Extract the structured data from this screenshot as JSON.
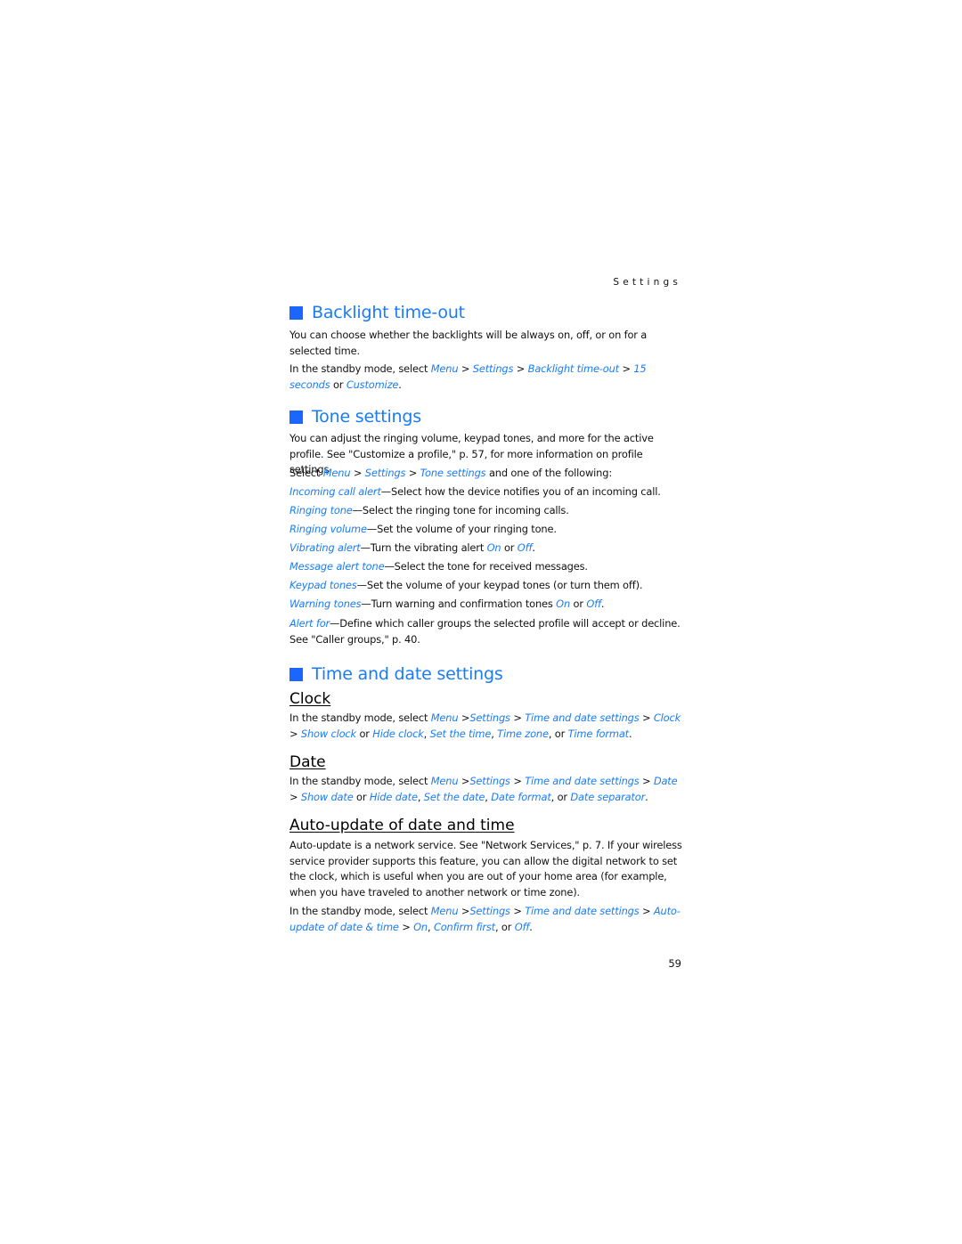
{
  "running_header": "Settings",
  "page_number": "59",
  "accent_color": "#1a7cf5",
  "sections": {
    "backlight": {
      "title": "Backlight time-out",
      "p1": "You can choose whether the backlights will be always on, off, or on for a selected time.",
      "p2": {
        "t1": "In the standby mode, select ",
        "l1": "Menu",
        "s1": " > ",
        "l2": "Settings",
        "s2": " > ",
        "l3": "Backlight time-out",
        "s3": " > ",
        "l4": "15 seconds",
        "s4": " or ",
        "l5": "Customize",
        "end": "."
      }
    },
    "tone": {
      "title": "Tone settings",
      "p1": "You can adjust the ringing volume, keypad tones, and more for the active profile. See \"Customize a profile,\" p. 57, for more information on profile settings.",
      "p2": {
        "t1": "Select ",
        "l1": "Menu",
        "s1": " > ",
        "l2": "Settings",
        "s2": " > ",
        "l3": "Tone settings",
        "t2": " and one of the following:"
      },
      "items": [
        {
          "term": "Incoming call alert",
          "desc": "—Select how the device notifies you of an incoming call."
        },
        {
          "term": "Ringing tone",
          "desc": "—Select the ringing tone for incoming calls."
        },
        {
          "term": "Ringing volume",
          "desc": "—Set the volume of your ringing tone."
        },
        {
          "term": "Vibrating alert",
          "desc": "—Turn the vibrating alert ",
          "on": "On",
          "or": " or ",
          "off": "Off",
          "end": "."
        },
        {
          "term": "Message alert tone",
          "desc": "—Select the tone for received messages."
        },
        {
          "term": "Keypad tones",
          "desc": "—Set the volume of your keypad tones (or turn them off)."
        },
        {
          "term": "Warning tones",
          "desc": "—Turn warning and confirmation tones ",
          "on": "On",
          "or": " or ",
          "off": "Off",
          "end": "."
        },
        {
          "term": "Alert for",
          "desc": "—Define which caller groups the selected profile will accept or decline. See \"Caller groups,\" p. 40."
        }
      ]
    },
    "timedate": {
      "title": "Time and date settings",
      "clock": {
        "title": "Clock",
        "t1": "In the standby mode, select ",
        "l1": "Menu",
        "s1": " >",
        "l2": "Settings",
        "s2": " > ",
        "l3": "Time and date settings",
        "s3": " > ",
        "l4": "Clock",
        "s4": " > ",
        "l5": "Show clock",
        "t2": " or ",
        "l6": "Hide clock",
        "t3": ", ",
        "l7": "Set the time",
        "t4": ", ",
        "l8": "Time zone",
        "t5": ", or ",
        "l9": "Time format",
        "end": "."
      },
      "date": {
        "title": "Date",
        "t1": "In the standby mode, select ",
        "l1": "Menu",
        "s1": " >",
        "l2": "Settings",
        "s2": " > ",
        "l3": "Time and date settings",
        "s3": " > ",
        "l4": "Date",
        "s4": " > ",
        "l5": "Show date",
        "t2": " or ",
        "l6": "Hide date",
        "t3": ", ",
        "l7": "Set the date",
        "t4": ", ",
        "l8": "Date format",
        "t5": ", or ",
        "l9": "Date separator",
        "end": "."
      },
      "auto": {
        "title": "Auto-update of date and time",
        "p1": "Auto-update is a network service. See \"Network Services,\" p. 7. If your wireless service provider supports this feature, you can allow the digital network to set the clock, which is useful when you are out of your home area (for example, when you have traveled to another network or time zone).",
        "t1": "In the standby mode, select ",
        "l1": "Menu",
        "s1": " >",
        "l2": "Settings",
        "s2": " > ",
        "l3": "Time and date settings",
        "s3": " > ",
        "l4": "Auto-update of date & time",
        "s4": " > ",
        "l5": "On",
        "t2": ", ",
        "l6": "Confirm first",
        "t3": ", or ",
        "l7": "Off",
        "end": "."
      }
    }
  }
}
